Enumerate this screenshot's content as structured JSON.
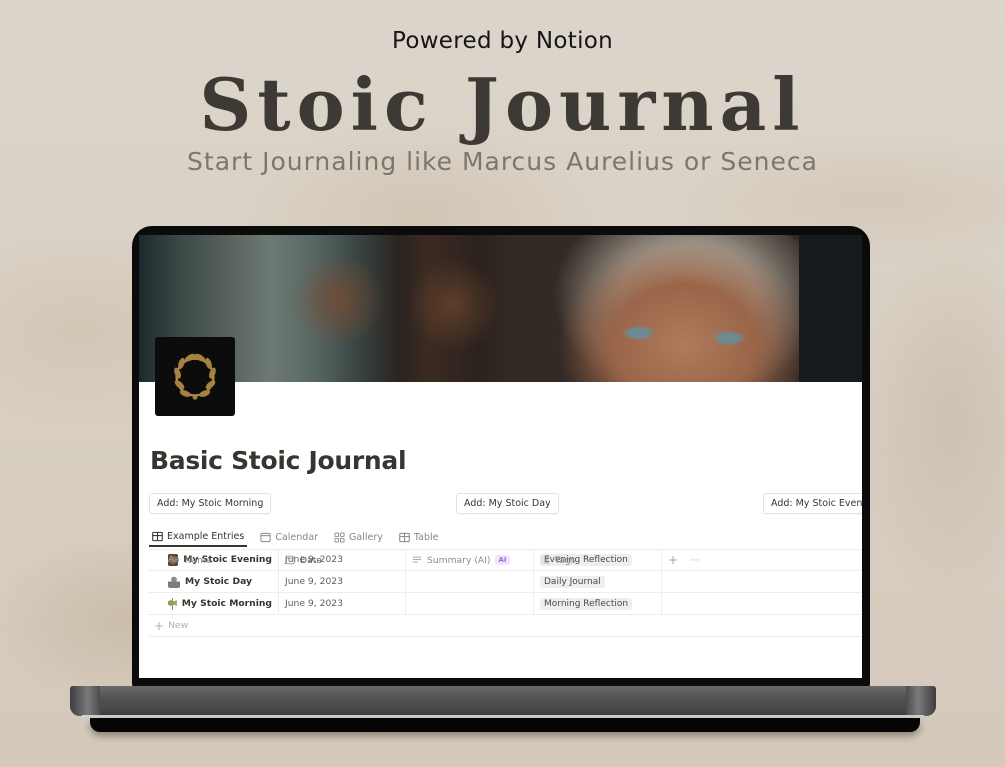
{
  "hero": {
    "powered_by": "Powered by Notion",
    "title": "Stoic Journal",
    "subtitle": "Start Journaling like Marcus Aurelius or Seneca"
  },
  "page": {
    "icon": "laurel-wreath-icon",
    "title": "Basic Stoic Journal",
    "buttons": [
      {
        "label": "Add: My Stoic Morning"
      },
      {
        "label": "Add: My Stoic Day"
      },
      {
        "label": "Add: My Stoic Evening"
      }
    ]
  },
  "database": {
    "tabs": [
      {
        "label": "Example Entries",
        "icon": "table-icon",
        "active": true
      },
      {
        "label": "Calendar",
        "icon": "calendar-icon",
        "active": false
      },
      {
        "label": "Gallery",
        "icon": "gallery-icon",
        "active": false
      },
      {
        "label": "Table",
        "icon": "table-icon",
        "active": false
      }
    ],
    "columns": [
      {
        "label": "Name",
        "icon_text": "Aa"
      },
      {
        "label": "Date",
        "icon": "calendar-icon"
      },
      {
        "label": "Summary (AI)",
        "icon": "text-lines-icon",
        "badge": "AI"
      },
      {
        "label": "Tags",
        "icon": "list-icon"
      }
    ],
    "add_column": "+",
    "more_options": "···",
    "rows": [
      {
        "name": "My Stoic Evening",
        "icon": "evening-icon",
        "date": "June 9, 2023",
        "summary": "",
        "tag": "Evening Reflection"
      },
      {
        "name": "My Stoic Day",
        "icon": "statue-icon",
        "date": "June 9, 2023",
        "summary": "",
        "tag": "Daily Journal"
      },
      {
        "name": "My Stoic Morning",
        "icon": "sprout-icon",
        "date": "June 9, 2023",
        "summary": "",
        "tag": "Morning Reflection"
      }
    ],
    "new_label": "New",
    "new_icon": "+"
  },
  "colors": {
    "text": "#37352f",
    "muted": "#8a8883",
    "ai_badge": "#9a6dd7",
    "title": "#3d3935"
  }
}
